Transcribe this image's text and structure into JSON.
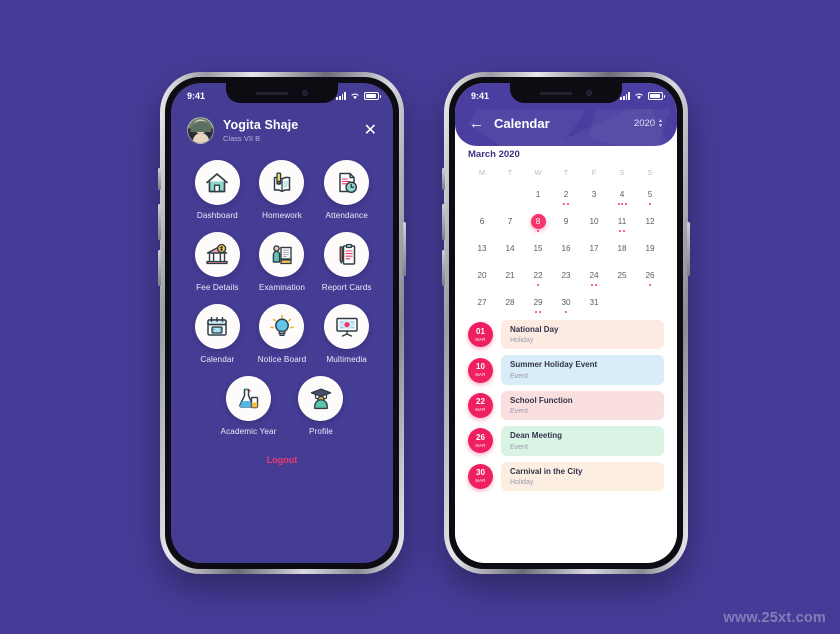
{
  "canvas": {
    "background": "#463C98",
    "watermark": "www.25xt.com"
  },
  "phone_left": {
    "status": {
      "time": "9:41",
      "signal_icon": "signal-bars-icon",
      "wifi_icon": "wifi-icon",
      "battery_icon": "battery-icon"
    },
    "profile": {
      "name": "Yogita Shaje",
      "class": "Class VII B",
      "avatar_icon": "avatar",
      "close_icon": "✕"
    },
    "menu": [
      {
        "label": "Dashboard",
        "icon": "home-icon"
      },
      {
        "label": "Homework",
        "icon": "book-pencil-icon"
      },
      {
        "label": "Attendance",
        "icon": "document-clock-icon"
      },
      {
        "label": "Fee Details",
        "icon": "bank-coin-icon"
      },
      {
        "label": "Examination",
        "icon": "teacher-board-icon"
      },
      {
        "label": "Report Cards",
        "icon": "clipboard-pencil-icon"
      },
      {
        "label": "Calendar",
        "icon": "calendar-icon"
      },
      {
        "label": "Notice Board",
        "icon": "lightbulb-icon"
      },
      {
        "label": "Multimedia",
        "icon": "presentation-screen-icon"
      },
      {
        "label": "Academic Year",
        "icon": "flask-chemistry-icon"
      },
      {
        "label": "Profile",
        "icon": "graduate-icon"
      }
    ],
    "logout_label": "Logout",
    "accent": "#ef3a6e"
  },
  "phone_right": {
    "status": {
      "time": "9:41",
      "signal_icon": "signal-bars-icon",
      "wifi_icon": "wifi-icon",
      "battery_icon": "battery-icon"
    },
    "header": {
      "back_icon": "←",
      "title": "Calendar",
      "year": "2020",
      "spinner_icon": "stepper-up-down-icon"
    },
    "calendar": {
      "month_label": "March 2020",
      "day_initials": [
        "M",
        "T",
        "W",
        "T",
        "F",
        "S",
        "S"
      ],
      "today": 8,
      "today_color": "#f4366d",
      "weeks": [
        [
          null,
          null,
          1,
          2,
          3,
          4,
          5
        ],
        [
          6,
          7,
          8,
          9,
          10,
          11,
          12
        ],
        [
          13,
          14,
          15,
          16,
          17,
          18,
          19
        ],
        [
          20,
          21,
          22,
          23,
          24,
          25,
          26
        ],
        [
          27,
          28,
          29,
          30,
          31,
          null,
          null
        ]
      ],
      "dots": {
        "2": 2,
        "4": 3,
        "5": 1,
        "8": 1,
        "11": 2,
        "22": 1,
        "24": 2,
        "26": 1,
        "29": 2,
        "30": 1
      }
    },
    "events": [
      {
        "day": "01",
        "month": "MAR",
        "title": "National Day",
        "type": "Holiday",
        "card_color": "#fdebe3"
      },
      {
        "day": "10",
        "month": "MAR",
        "title": "Summer Holiday Event",
        "type": "Event",
        "card_color": "#d9edf9"
      },
      {
        "day": "22",
        "month": "MAR",
        "title": "School Function",
        "type": "Event",
        "card_color": "#fadfdf"
      },
      {
        "day": "26",
        "month": "MAR",
        "title": "Dean Meeting",
        "type": "Event",
        "card_color": "#d9f3e4"
      },
      {
        "day": "30",
        "month": "MAR",
        "title": "Carnival in the City",
        "type": "Holiday",
        "card_color": "#fdeee2"
      }
    ],
    "badge_color": "#ef2060"
  }
}
